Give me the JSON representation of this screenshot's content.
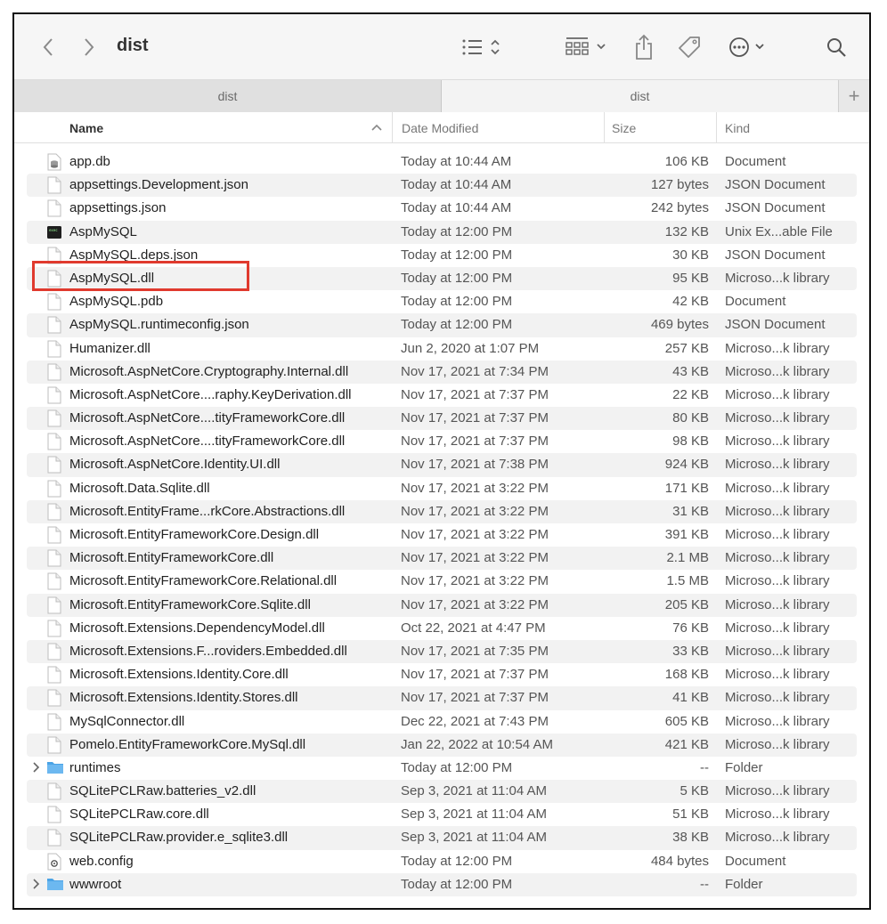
{
  "toolbar": {
    "title": "dist",
    "icons": [
      "chevron-left-icon",
      "chevron-right-icon",
      "list-view-icon",
      "group-icon",
      "share-icon",
      "tag-icon",
      "more-icon",
      "search-icon"
    ]
  },
  "tabs": [
    {
      "label": "dist"
    },
    {
      "label": "dist"
    },
    {
      "label": "+"
    }
  ],
  "columns": {
    "name": "Name",
    "date": "Date Modified",
    "size": "Size",
    "kind": "Kind"
  },
  "colors": {
    "highlight": "#e03a2e",
    "folder": "#4aa3e6",
    "alt_row": "#f2f2f2"
  },
  "files": [
    {
      "name": "app.db",
      "date": "Today at 10:44 AM",
      "size": "106 KB",
      "kind": "Document",
      "icon": "db"
    },
    {
      "name": "appsettings.Development.json",
      "date": "Today at 10:44 AM",
      "size": "127 bytes",
      "kind": "JSON Document",
      "icon": "doc"
    },
    {
      "name": "appsettings.json",
      "date": "Today at 10:44 AM",
      "size": "242 bytes",
      "kind": "JSON Document",
      "icon": "doc"
    },
    {
      "name": "AspMySQL",
      "date": "Today at 12:00 PM",
      "size": "132 KB",
      "kind": "Unix Ex...able File",
      "icon": "exec"
    },
    {
      "name": "AspMySQL.deps.json",
      "date": "Today at 12:00 PM",
      "size": "30 KB",
      "kind": "JSON Document",
      "icon": "doc"
    },
    {
      "name": "AspMySQL.dll",
      "date": "Today at 12:00 PM",
      "size": "95 KB",
      "kind": "Microso...k library",
      "icon": "doc"
    },
    {
      "name": "AspMySQL.pdb",
      "date": "Today at 12:00 PM",
      "size": "42 KB",
      "kind": "Document",
      "icon": "doc"
    },
    {
      "name": "AspMySQL.runtimeconfig.json",
      "date": "Today at 12:00 PM",
      "size": "469 bytes",
      "kind": "JSON Document",
      "icon": "doc"
    },
    {
      "name": "Humanizer.dll",
      "date": "Jun 2, 2020 at 1:07 PM",
      "size": "257 KB",
      "kind": "Microso...k library",
      "icon": "doc"
    },
    {
      "name": "Microsoft.AspNetCore.Cryptography.Internal.dll",
      "date": "Nov 17, 2021 at 7:34 PM",
      "size": "43 KB",
      "kind": "Microso...k library",
      "icon": "doc"
    },
    {
      "name": "Microsoft.AspNetCore....raphy.KeyDerivation.dll",
      "date": "Nov 17, 2021 at 7:37 PM",
      "size": "22 KB",
      "kind": "Microso...k library",
      "icon": "doc"
    },
    {
      "name": "Microsoft.AspNetCore....tityFrameworkCore.dll",
      "date": "Nov 17, 2021 at 7:37 PM",
      "size": "80 KB",
      "kind": "Microso...k library",
      "icon": "doc"
    },
    {
      "name": "Microsoft.AspNetCore....tityFrameworkCore.dll",
      "date": "Nov 17, 2021 at 7:37 PM",
      "size": "98 KB",
      "kind": "Microso...k library",
      "icon": "doc"
    },
    {
      "name": "Microsoft.AspNetCore.Identity.UI.dll",
      "date": "Nov 17, 2021 at 7:38 PM",
      "size": "924 KB",
      "kind": "Microso...k library",
      "icon": "doc"
    },
    {
      "name": "Microsoft.Data.Sqlite.dll",
      "date": "Nov 17, 2021 at 3:22 PM",
      "size": "171 KB",
      "kind": "Microso...k library",
      "icon": "doc"
    },
    {
      "name": "Microsoft.EntityFrame...rkCore.Abstractions.dll",
      "date": "Nov 17, 2021 at 3:22 PM",
      "size": "31 KB",
      "kind": "Microso...k library",
      "icon": "doc"
    },
    {
      "name": "Microsoft.EntityFrameworkCore.Design.dll",
      "date": "Nov 17, 2021 at 3:22 PM",
      "size": "391 KB",
      "kind": "Microso...k library",
      "icon": "doc"
    },
    {
      "name": "Microsoft.EntityFrameworkCore.dll",
      "date": "Nov 17, 2021 at 3:22 PM",
      "size": "2.1 MB",
      "kind": "Microso...k library",
      "icon": "doc"
    },
    {
      "name": "Microsoft.EntityFrameworkCore.Relational.dll",
      "date": "Nov 17, 2021 at 3:22 PM",
      "size": "1.5 MB",
      "kind": "Microso...k library",
      "icon": "doc"
    },
    {
      "name": "Microsoft.EntityFrameworkCore.Sqlite.dll",
      "date": "Nov 17, 2021 at 3:22 PM",
      "size": "205 KB",
      "kind": "Microso...k library",
      "icon": "doc"
    },
    {
      "name": "Microsoft.Extensions.DependencyModel.dll",
      "date": "Oct 22, 2021 at 4:47 PM",
      "size": "76 KB",
      "kind": "Microso...k library",
      "icon": "doc"
    },
    {
      "name": "Microsoft.Extensions.F...roviders.Embedded.dll",
      "date": "Nov 17, 2021 at 7:35 PM",
      "size": "33 KB",
      "kind": "Microso...k library",
      "icon": "doc"
    },
    {
      "name": "Microsoft.Extensions.Identity.Core.dll",
      "date": "Nov 17, 2021 at 7:37 PM",
      "size": "168 KB",
      "kind": "Microso...k library",
      "icon": "doc"
    },
    {
      "name": "Microsoft.Extensions.Identity.Stores.dll",
      "date": "Nov 17, 2021 at 7:37 PM",
      "size": "41 KB",
      "kind": "Microso...k library",
      "icon": "doc"
    },
    {
      "name": "MySqlConnector.dll",
      "date": "Dec 22, 2021 at 7:43 PM",
      "size": "605 KB",
      "kind": "Microso...k library",
      "icon": "doc"
    },
    {
      "name": "Pomelo.EntityFrameworkCore.MySql.dll",
      "date": "Jan 22, 2022 at 10:54 AM",
      "size": "421 KB",
      "kind": "Microso...k library",
      "icon": "doc"
    },
    {
      "name": "runtimes",
      "date": "Today at 12:00 PM",
      "size": "--",
      "kind": "Folder",
      "icon": "folder"
    },
    {
      "name": "SQLitePCLRaw.batteries_v2.dll",
      "date": "Sep 3, 2021 at 11:04 AM",
      "size": "5 KB",
      "kind": "Microso...k library",
      "icon": "doc"
    },
    {
      "name": "SQLitePCLRaw.core.dll",
      "date": "Sep 3, 2021 at 11:04 AM",
      "size": "51 KB",
      "kind": "Microso...k library",
      "icon": "doc"
    },
    {
      "name": "SQLitePCLRaw.provider.e_sqlite3.dll",
      "date": "Sep 3, 2021 at 11:04 AM",
      "size": "38 KB",
      "kind": "Microso...k library",
      "icon": "doc"
    },
    {
      "name": "web.config",
      "date": "Today at 12:00 PM",
      "size": "484 bytes",
      "kind": "Document",
      "icon": "config"
    },
    {
      "name": "wwwroot",
      "date": "Today at 12:00 PM",
      "size": "--",
      "kind": "Folder",
      "icon": "folder"
    }
  ]
}
